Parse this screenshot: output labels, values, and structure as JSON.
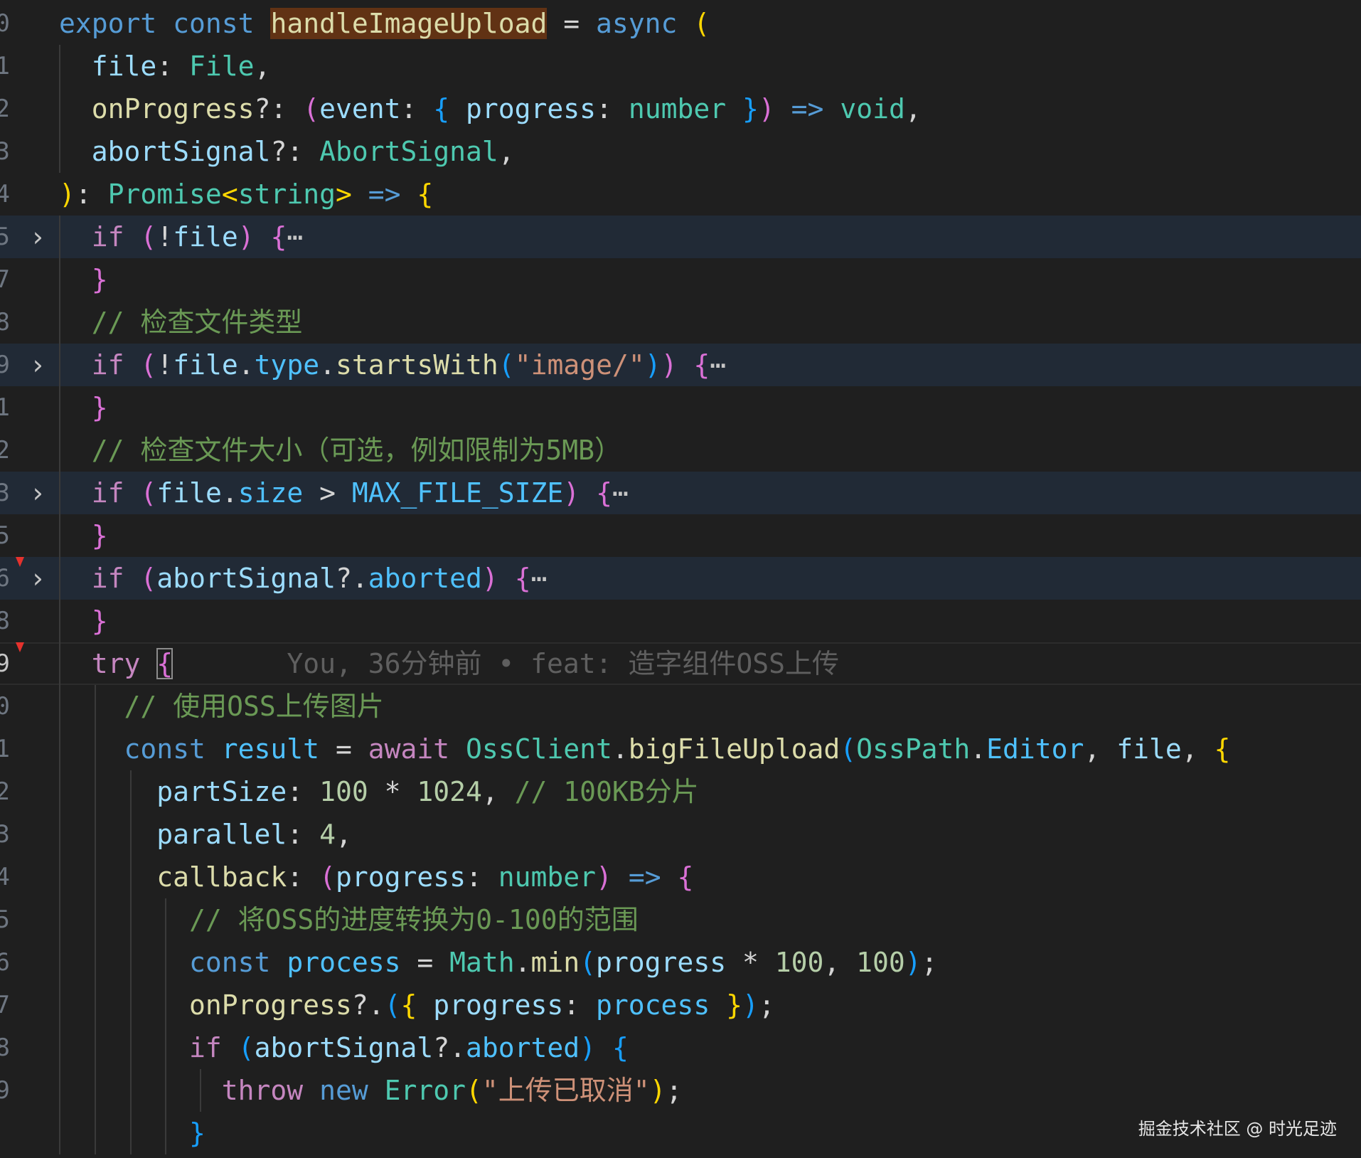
{
  "editor": {
    "line_numbers": [
      "0",
      "1",
      "2",
      "3",
      "4",
      "5",
      "7",
      "8",
      "9",
      "1",
      "2",
      "3",
      "5",
      "6",
      "8",
      "9",
      "0",
      "1",
      "2",
      "3",
      "4",
      "5",
      "6",
      "7",
      "8",
      "9",
      ""
    ],
    "active_line_number": "9",
    "watermark": "掘金技术社区 @ 时光足迹",
    "lines": [
      [
        [
          "kb",
          "export"
        ],
        [
          "pu",
          " "
        ],
        [
          "kb",
          "const"
        ],
        [
          "pu",
          " "
        ],
        [
          "fnhl",
          "handleImageUpload"
        ],
        [
          "pu",
          " = "
        ],
        [
          "kb",
          "async"
        ],
        [
          "pu",
          " "
        ],
        [
          "b1",
          "("
        ]
      ],
      [
        [
          "pu",
          "  "
        ],
        [
          "va",
          "file"
        ],
        [
          "pu",
          ": "
        ],
        [
          "ty",
          "File"
        ],
        [
          "pu",
          ","
        ]
      ],
      [
        [
          "pu",
          "  "
        ],
        [
          "fn",
          "onProgress"
        ],
        [
          "pu",
          "?: "
        ],
        [
          "b2",
          "("
        ],
        [
          "va",
          "event"
        ],
        [
          "pu",
          ": "
        ],
        [
          "b3",
          "{"
        ],
        [
          "pu",
          " "
        ],
        [
          "va",
          "progress"
        ],
        [
          "pu",
          ": "
        ],
        [
          "ty",
          "number"
        ],
        [
          "pu",
          " "
        ],
        [
          "b3",
          "}"
        ],
        [
          "b2",
          ")"
        ],
        [
          "pu",
          " "
        ],
        [
          "kb",
          "=>"
        ],
        [
          "pu",
          " "
        ],
        [
          "ty",
          "void"
        ],
        [
          "pu",
          ","
        ]
      ],
      [
        [
          "pu",
          "  "
        ],
        [
          "va",
          "abortSignal"
        ],
        [
          "pu",
          "?: "
        ],
        [
          "ty",
          "AbortSignal"
        ],
        [
          "pu",
          ","
        ]
      ],
      [
        [
          "b1",
          ")"
        ],
        [
          "pu",
          ": "
        ],
        [
          "ty",
          "Promise"
        ],
        [
          "b1",
          "<"
        ],
        [
          "ty",
          "string"
        ],
        [
          "b1",
          ">"
        ],
        [
          "pu",
          " "
        ],
        [
          "kb",
          "=>"
        ],
        [
          "pu",
          " "
        ],
        [
          "b1",
          "{"
        ]
      ],
      [
        [
          "pu",
          "  "
        ],
        [
          "kw",
          "if"
        ],
        [
          "pu",
          " "
        ],
        [
          "b2",
          "("
        ],
        [
          "pu",
          "!"
        ],
        [
          "va",
          "file"
        ],
        [
          "b2",
          ")"
        ],
        [
          "pu",
          " "
        ],
        [
          "b2",
          "{"
        ],
        [
          "fold-ell",
          "⋯"
        ]
      ],
      [
        [
          "pu",
          "  "
        ],
        [
          "b2",
          "}"
        ]
      ],
      [
        [
          "pu",
          "  "
        ],
        [
          "cm",
          "// 检查文件类型"
        ]
      ],
      [
        [
          "pu",
          "  "
        ],
        [
          "kw",
          "if"
        ],
        [
          "pu",
          " "
        ],
        [
          "b2",
          "("
        ],
        [
          "pu",
          "!"
        ],
        [
          "va",
          "file"
        ],
        [
          "pu",
          "."
        ],
        [
          "pr",
          "type"
        ],
        [
          "pu",
          "."
        ],
        [
          "fn",
          "startsWith"
        ],
        [
          "b3",
          "("
        ],
        [
          "st",
          "\"image/\""
        ],
        [
          "b3",
          ")"
        ],
        [
          "b2",
          ")"
        ],
        [
          "pu",
          " "
        ],
        [
          "b2",
          "{"
        ],
        [
          "fold-ell",
          "⋯"
        ]
      ],
      [
        [
          "pu",
          "  "
        ],
        [
          "b2",
          "}"
        ]
      ],
      [
        [
          "pu",
          "  "
        ],
        [
          "cm",
          "// 检查文件大小（可选，例如限制为5MB）"
        ]
      ],
      [
        [
          "pu",
          "  "
        ],
        [
          "kw",
          "if"
        ],
        [
          "pu",
          " "
        ],
        [
          "b2",
          "("
        ],
        [
          "va",
          "file"
        ],
        [
          "pu",
          "."
        ],
        [
          "pr",
          "size"
        ],
        [
          "pu",
          " > "
        ],
        [
          "pr",
          "MAX_FILE_SIZE"
        ],
        [
          "b2",
          ")"
        ],
        [
          "pu",
          " "
        ],
        [
          "b2",
          "{"
        ],
        [
          "fold-ell",
          "⋯"
        ]
      ],
      [
        [
          "pu",
          "  "
        ],
        [
          "b2",
          "}"
        ]
      ],
      [
        [
          "pu",
          "  "
        ],
        [
          "kw",
          "if"
        ],
        [
          "pu",
          " "
        ],
        [
          "b2",
          "("
        ],
        [
          "va",
          "abortSignal"
        ],
        [
          "pu",
          "?."
        ],
        [
          "pr",
          "aborted"
        ],
        [
          "b2",
          ")"
        ],
        [
          "pu",
          " "
        ],
        [
          "b2",
          "{"
        ],
        [
          "fold-ell",
          "⋯"
        ]
      ],
      [
        [
          "pu",
          "  "
        ],
        [
          "b2",
          "}"
        ]
      ],
      [
        [
          "pu",
          "  "
        ],
        [
          "kw",
          "try"
        ],
        [
          "pu",
          " "
        ],
        [
          "b2cur",
          "{"
        ],
        [
          "pu",
          "       "
        ],
        [
          "blame",
          "You, 36分钟前 • feat: 造字组件OSS上传"
        ]
      ],
      [
        [
          "pu",
          "    "
        ],
        [
          "cm",
          "// 使用OSS上传图片"
        ]
      ],
      [
        [
          "pu",
          "    "
        ],
        [
          "kb",
          "const"
        ],
        [
          "pu",
          " "
        ],
        [
          "pr",
          "result"
        ],
        [
          "pu",
          " = "
        ],
        [
          "kw",
          "await"
        ],
        [
          "pu",
          " "
        ],
        [
          "ty",
          "OssClient"
        ],
        [
          "pu",
          "."
        ],
        [
          "fn",
          "bigFileUpload"
        ],
        [
          "b3",
          "("
        ],
        [
          "ty",
          "OssPath"
        ],
        [
          "pu",
          "."
        ],
        [
          "pr",
          "Editor"
        ],
        [
          "pu",
          ", "
        ],
        [
          "va",
          "file"
        ],
        [
          "pu",
          ", "
        ],
        [
          "b1",
          "{"
        ]
      ],
      [
        [
          "pu",
          "      "
        ],
        [
          "va",
          "partSize"
        ],
        [
          "pu",
          ": "
        ],
        [
          "nu",
          "100"
        ],
        [
          "pu",
          " * "
        ],
        [
          "nu",
          "1024"
        ],
        [
          "pu",
          ", "
        ],
        [
          "cm",
          "// 100KB分片"
        ]
      ],
      [
        [
          "pu",
          "      "
        ],
        [
          "va",
          "parallel"
        ],
        [
          "pu",
          ": "
        ],
        [
          "nu",
          "4"
        ],
        [
          "pu",
          ","
        ]
      ],
      [
        [
          "pu",
          "      "
        ],
        [
          "fn",
          "callback"
        ],
        [
          "pu",
          ": "
        ],
        [
          "b2",
          "("
        ],
        [
          "va",
          "progress"
        ],
        [
          "pu",
          ": "
        ],
        [
          "ty",
          "number"
        ],
        [
          "b2",
          ")"
        ],
        [
          "pu",
          " "
        ],
        [
          "kb",
          "=>"
        ],
        [
          "pu",
          " "
        ],
        [
          "b2",
          "{"
        ]
      ],
      [
        [
          "pu",
          "        "
        ],
        [
          "cm",
          "// 将OSS的进度转换为0-100的范围"
        ]
      ],
      [
        [
          "pu",
          "        "
        ],
        [
          "kb",
          "const"
        ],
        [
          "pu",
          " "
        ],
        [
          "pr",
          "process"
        ],
        [
          "pu",
          " = "
        ],
        [
          "ty",
          "Math"
        ],
        [
          "pu",
          "."
        ],
        [
          "fn",
          "min"
        ],
        [
          "b3",
          "("
        ],
        [
          "va",
          "progress"
        ],
        [
          "pu",
          " * "
        ],
        [
          "nu",
          "100"
        ],
        [
          "pu",
          ", "
        ],
        [
          "nu",
          "100"
        ],
        [
          "b3",
          ")"
        ],
        [
          "pu",
          ";"
        ]
      ],
      [
        [
          "pu",
          "        "
        ],
        [
          "fn",
          "onProgress"
        ],
        [
          "pu",
          "?."
        ],
        [
          "b3",
          "("
        ],
        [
          "b1",
          "{"
        ],
        [
          "pu",
          " "
        ],
        [
          "va",
          "progress"
        ],
        [
          "pu",
          ": "
        ],
        [
          "pr",
          "process"
        ],
        [
          "pu",
          " "
        ],
        [
          "b1",
          "}"
        ],
        [
          "b3",
          ")"
        ],
        [
          "pu",
          ";"
        ]
      ],
      [
        [
          "pu",
          "        "
        ],
        [
          "kw",
          "if"
        ],
        [
          "pu",
          " "
        ],
        [
          "b3",
          "("
        ],
        [
          "va",
          "abortSignal"
        ],
        [
          "pu",
          "?."
        ],
        [
          "pr",
          "aborted"
        ],
        [
          "b3",
          ")"
        ],
        [
          "pu",
          " "
        ],
        [
          "b3",
          "{"
        ]
      ],
      [
        [
          "pu",
          "          "
        ],
        [
          "kw",
          "throw"
        ],
        [
          "pu",
          " "
        ],
        [
          "kb",
          "new"
        ],
        [
          "pu",
          " "
        ],
        [
          "ty",
          "Error"
        ],
        [
          "b1",
          "("
        ],
        [
          "st",
          "\"上传已取消\""
        ],
        [
          "b1",
          ")"
        ],
        [
          "pu",
          ";"
        ]
      ],
      [
        [
          "pu",
          "        "
        ],
        [
          "b3",
          "}"
        ]
      ]
    ]
  }
}
